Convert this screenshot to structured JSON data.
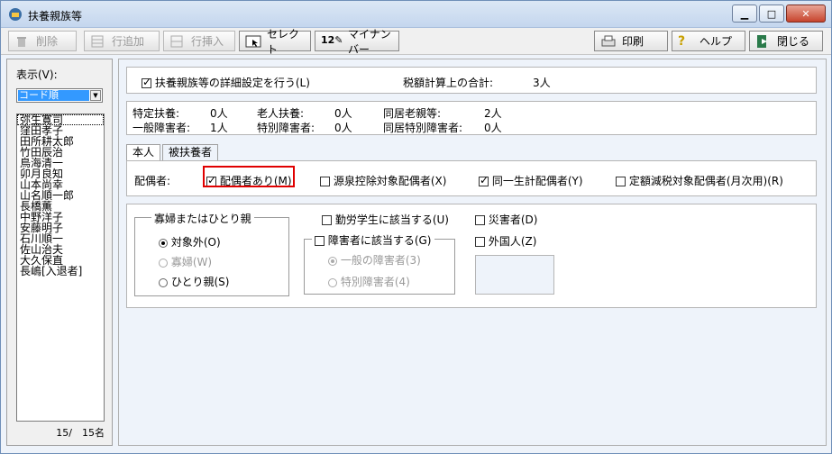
{
  "window": {
    "title": "扶養親族等"
  },
  "toolbar": {
    "delete_label": "削除",
    "add_row_label": "行追加",
    "insert_row_label": "行挿入",
    "select_label": "セレクト",
    "mynumber_label": "マイナンバー",
    "print_label": "印刷",
    "help_label": "ヘルプ",
    "close_label": "閉じる"
  },
  "left": {
    "view_label": "表示(V):",
    "sort_selected": "コード順",
    "employees": [
      "弥生寛司",
      "窪田孝子",
      "田所耕太郎",
      "竹田辰治",
      "鳥海清一",
      "卯月良知",
      "山本尚幸",
      "山名順一郎",
      "長橋薫",
      "中野洋子",
      "安藤明子",
      "石川順一",
      "佐山治夫",
      "大久保直",
      "長嶋[入退者]"
    ],
    "count_text": "15/　15名"
  },
  "main": {
    "detail_setting_label": "扶養親族等の詳細設定を行う(L)",
    "tax_total_label": "税額計算上の合計:",
    "tax_total_value": "3人",
    "summary": {
      "specific_label": "特定扶養:",
      "specific_value": "0人",
      "elderly_label": "老人扶養:",
      "elderly_value": "0人",
      "cohabit_elderly_label": "同居老親等:",
      "cohabit_elderly_value": "2人",
      "general_disabled_label": "一般障害者:",
      "general_disabled_value": "1人",
      "special_disabled_label": "特別障害者:",
      "special_disabled_value": "0人",
      "cohabit_special_label": "同居特別障害者:",
      "cohabit_special_value": "0人"
    },
    "tabs": [
      "本人",
      "被扶養者"
    ],
    "spouse_label": "配偶者:",
    "spouse_exists_label": "配偶者あり(M)",
    "withholding_spouse_label": "源泉控除対象配偶者(X)",
    "same_household_label": "同一生計配偶者(Y)",
    "fixed_reduction_label": "定額減税対象配偶者(月次用)(R)",
    "widow_group_title": "寡婦またはひとり親",
    "widow_options": [
      "対象外(O)",
      "寡婦(W)",
      "ひとり親(S)"
    ],
    "working_student_label": "勤労学生に該当する(U)",
    "disabled_label": "障害者に該当する(G)",
    "disabled_options": [
      "一般の障害者(3)",
      "特別障害者(4)"
    ],
    "disaster_label": "災害者(D)",
    "foreigner_label": "外国人(Z)"
  },
  "colors": {
    "highlight": "#e00000",
    "selection": "#3399ff"
  }
}
